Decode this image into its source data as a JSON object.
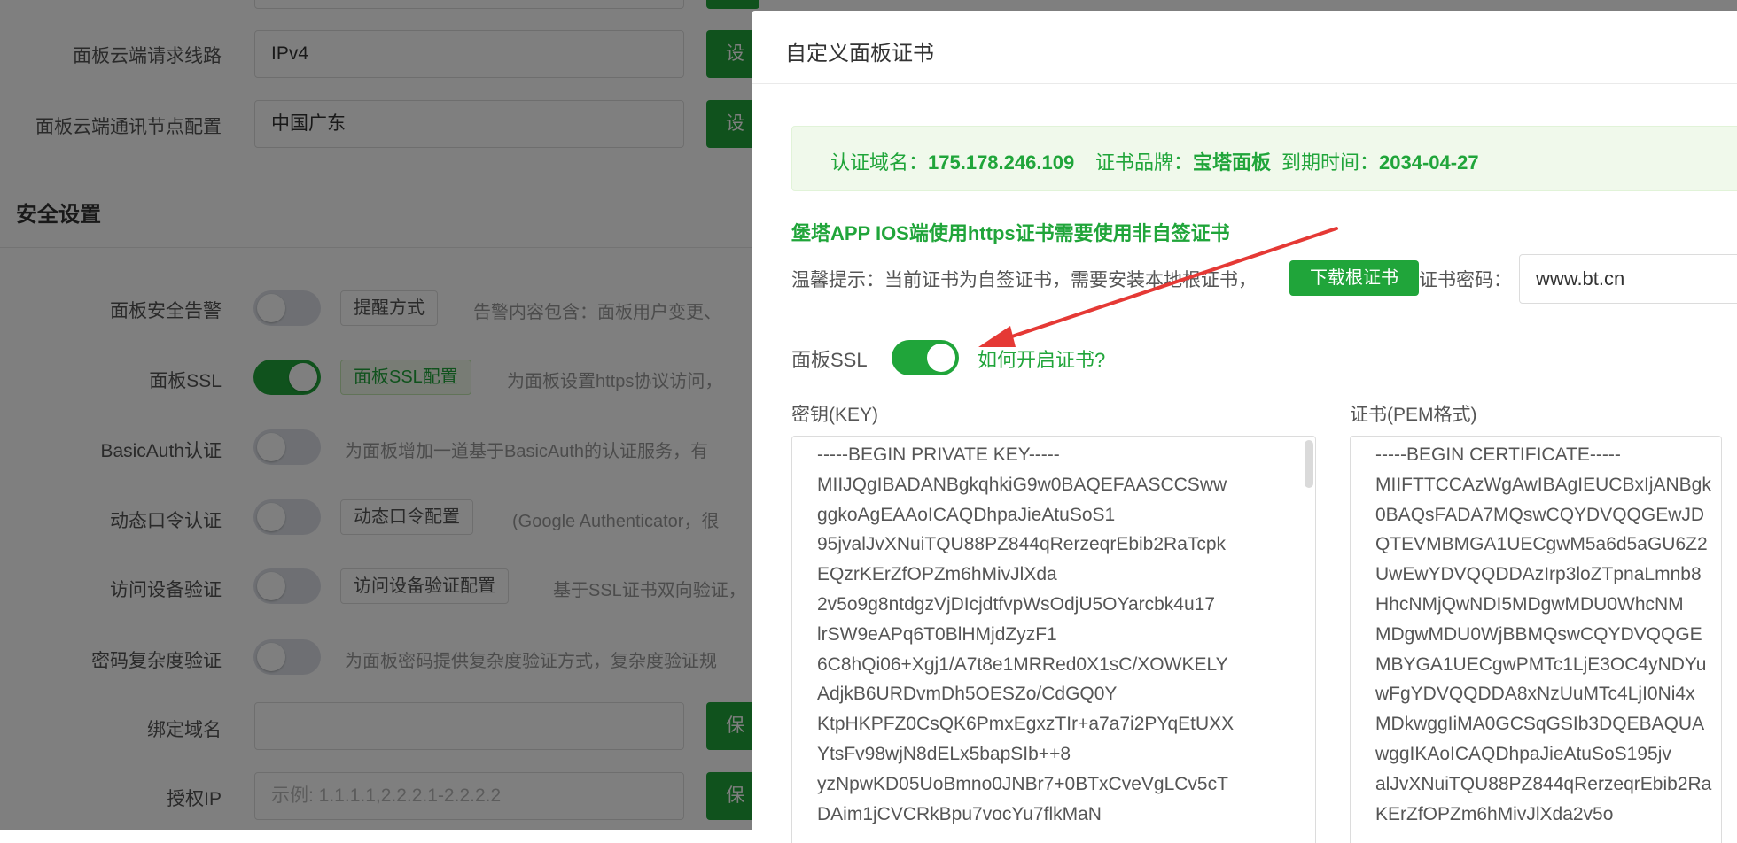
{
  "background": {
    "rows": [
      {
        "label": "",
        "value": "",
        "button": ""
      },
      {
        "label": "面板云端请求线路",
        "value": "IPv4",
        "button": "设置"
      },
      {
        "label": "面板云端通讯节点配置",
        "value": "中国广东",
        "button": "设置"
      }
    ],
    "section_title": "安全设置",
    "security": [
      {
        "label": "面板安全告警",
        "on": false,
        "button": "提醒方式",
        "desc": "告警内容包含：面板用户变更、"
      },
      {
        "label": "面板SSL",
        "on": true,
        "button": "面板SSL配置",
        "desc": "为面板设置https协议访问，"
      },
      {
        "label": "BasicAuth认证",
        "on": false,
        "button": "",
        "desc": "为面板增加一道基于BasicAuth的认证服务，有"
      },
      {
        "label": "动态口令认证",
        "on": false,
        "button": "动态口令配置",
        "desc": "(Google Authenticator，很"
      },
      {
        "label": "访问设备验证",
        "on": false,
        "button": "访问设备验证配置",
        "desc": "基于SSL证书双向验证，"
      },
      {
        "label": "密码复杂度验证",
        "on": false,
        "button": "",
        "desc": "为面板密码提供复杂度验证方式，复杂度验证规"
      }
    ],
    "bind_domain": {
      "label": "绑定域名",
      "value": "",
      "button": "保存"
    },
    "auth_ip": {
      "label": "授权IP",
      "placeholder": "示例: 1.1.1.1,2.2.2.1-2.2.2.2",
      "button": "保存"
    }
  },
  "dialog": {
    "title": "自定义面板证书",
    "info": {
      "domain_label": "认证域名：",
      "domain_value": "175.178.246.109",
      "brand_label": "证书品牌：",
      "brand_value": "宝塔面板",
      "expire_label": "到期时间：",
      "expire_value": "2034-04-27"
    },
    "warning": "堡塔APP IOS端使用https证书需要使用非自签证书",
    "tip": "温馨提示：当前证书为自签证书，需要安装本地根证书，",
    "download_button": "下载根证书",
    "cert_password_label": "证书密码：",
    "cert_password_value": "www.bt.cn",
    "ssl_label": "面板SSL",
    "ssl_on": true,
    "howto_link": "如何开启证书?",
    "key_label": "密钥(KEY)",
    "pem_label": "证书(PEM格式)",
    "key_lines": [
      "-----BEGIN PRIVATE KEY-----",
      "MIIJQgIBADANBgkqhkiG9w0BAQEFAASCCSww",
      "ggkoAgEAAoICAQDhpaJieAtuSoS1",
      "95jvalJvXNuiTQU88PZ844qRerzeqrEbib2RaTcpk",
      "EQzrKErZfOPZm6hMivJlXda",
      "2v5o9g8ntdgzVjDIcjdtfvpWsOdjU5OYarcbk4u17",
      "lrSW9eAPq6T0BlHMjdZyzF1",
      "6C8hQi06+Xgj1/A7t8e1MRRed0X1sC/XOWKELY",
      "AdjkB6URDvmDh5OESZo/CdGQ0Y",
      "KtpHKPFZ0CsQK6PmxEgxzTIr+a7a7i2PYqEtUXX",
      "YtsFv98wjN8dELx5bapSIb++8",
      "yzNpwKD05UoBmno0JNBr7+0BTxCveVgLCv5cT",
      "DAim1jCVCRkBpu7vocYu7flkMaN"
    ],
    "pem_lines": [
      "-----BEGIN CERTIFICATE-----",
      "MIIFTTCCAzWgAwIBAgIEUCBxIjANBgk",
      "0BAQsFADA7MQswCQYDVQQGEwJD",
      "QTEVMBMGA1UECgwM5a6d5aGU6Z2",
      "UwEwYDVQQDDAzIrp3loZTpnaLmnb8",
      "HhcNMjQwNDI5MDgwMDU0WhcNM",
      "MDgwMDU0WjBBMQswCQYDVQQGE",
      "MBYGA1UECgwPMTc1LjE3OC4yNDYu",
      "wFgYDVQQDDA8xNzUuMTc4LjI0Ni4x",
      "MDkwggIiMA0GCSqGSIb3DQEBAQUA",
      "wggIKAoICAQDhpaJieAtuSoS195jv",
      "alJvXNuiTQU88PZ844qRerzeqrEbib2Ra",
      "KErZfOPZm6hMivJlXda2v5o"
    ]
  },
  "colors": {
    "accent": "#20a53a",
    "overlay": "rgba(0,0,0,0.5)",
    "annotation_arrow": "#e53935"
  }
}
